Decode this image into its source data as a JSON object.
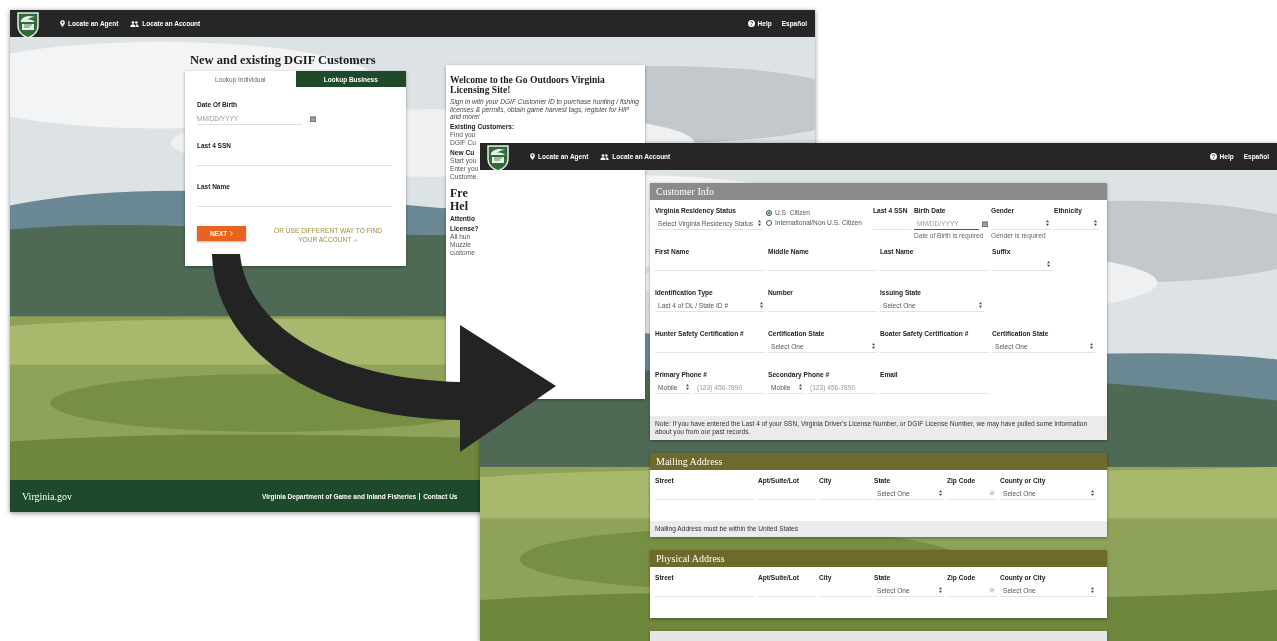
{
  "window_1": {
    "top_bar": {
      "nav": [
        "Locate an Agent",
        "Locate an Account"
      ],
      "help": "Help",
      "language": "Español"
    },
    "heading": "New and existing DGIF Customers",
    "tabs": [
      {
        "label": "Lookup Individual",
        "selected": true
      },
      {
        "label": "Lookup Business",
        "selected": false
      }
    ],
    "fields": [
      {
        "kind": "date",
        "label": "Date Of Birth",
        "placeholder": "MM/DD/YYYY"
      },
      {
        "kind": "text",
        "label": "Last 4 SSN"
      },
      {
        "kind": "text",
        "label": "Last Name"
      }
    ],
    "next_button": "NEXT",
    "alt_link": "OR USE DIFFERENT WAY TO FIND YOUR ACCOUNT",
    "welcome": {
      "title": "Welcome to the Go Outdoors Virginia Licensing Site!",
      "intro": "Sign in with your DGIF Customer ID to purchase hunting / fishing licenses & permits, obtain game harvest tags, register for HIP and more!",
      "sections": [
        {
          "kind": "label",
          "text": "Existing Customers:"
        },
        {
          "kind": "line",
          "text": "Find you"
        },
        {
          "kind": "line",
          "text": "DGIF Cu"
        },
        {
          "kind": "label",
          "text": "New Cu"
        },
        {
          "kind": "line",
          "text": "Start you"
        },
        {
          "kind": "line",
          "text": "Enter you"
        },
        {
          "kind": "line",
          "text": "Custome"
        },
        {
          "kind": "heading",
          "text": "Fre"
        },
        {
          "kind": "heading",
          "text": "Hel"
        },
        {
          "kind": "label",
          "text": "Attentio"
        },
        {
          "kind": "label",
          "text": "License?"
        },
        {
          "kind": "line",
          "text": "All hun"
        },
        {
          "kind": "line",
          "text": "Muzzle"
        },
        {
          "kind": "line",
          "text": "custome"
        }
      ]
    },
    "footer": {
      "brand": "Virginia.gov",
      "links": [
        "Virginia Department of Game and Inland Fisheries",
        "Contact Us"
      ]
    }
  },
  "window_2": {
    "top_bar": {
      "nav": [
        "Locate an Agent",
        "Locate an Account"
      ],
      "help": "Help",
      "language": "Español"
    },
    "cards": [
      {
        "kind": "info",
        "title": "Customer Info",
        "rows": [
          [
            {
              "kind": "select",
              "label": "Virginia Residency Status",
              "value": "Select Virginia Residency Status"
            },
            {
              "kind": "radio",
              "options": [
                {
                  "label": "U.S. Citizen",
                  "selected": true
                },
                {
                  "label": "International/Non U.S. Citizen",
                  "selected": false
                }
              ]
            },
            {
              "kind": "text",
              "label": "Last 4 SSN"
            },
            {
              "kind": "date",
              "label": "Birth Date",
              "placeholder": "MM/DD/YYYY",
              "error": "Date of Birth is required"
            },
            {
              "kind": "select",
              "label": "Gender",
              "error": "Gender is required"
            },
            {
              "kind": "select",
              "label": "Ethnicity"
            }
          ],
          [
            {
              "kind": "text",
              "label": "First Name"
            },
            {
              "kind": "text",
              "label": "Middle Name"
            },
            {
              "kind": "text",
              "label": "Last Name"
            },
            {
              "kind": "select",
              "label": "Suffix"
            }
          ],
          [
            {
              "kind": "select",
              "label": "Identification Type",
              "value": "Last 4 of DL / State ID #"
            },
            {
              "kind": "text",
              "label": "Number"
            },
            {
              "kind": "select",
              "label": "Issuing State",
              "value": "Select One"
            }
          ],
          [
            {
              "kind": "text",
              "label": "Hunter Safety Certification #"
            },
            {
              "kind": "select",
              "label": "Certification State",
              "value": "Select One"
            },
            {
              "kind": "text",
              "label": "Boater Safety Certification #"
            },
            {
              "kind": "select",
              "label": "Certification State",
              "value": "Select One"
            }
          ],
          [
            {
              "kind": "phone",
              "label": "Primary Phone #",
              "type": "Mobile",
              "placeholder": "(123) 456-7890"
            },
            {
              "kind": "phone",
              "label": "Secondary Phone #",
              "type": "Mobile",
              "placeholder": "(123) 456-7890"
            },
            {
              "kind": "text",
              "label": "Email"
            }
          ]
        ],
        "note": "Note: If you have entered the Last 4 of your SSN, Virginia Driver's License Number, or DGIF License Number, we may have pulled some information about you from our past records."
      },
      {
        "kind": "address",
        "title": "Mailing Address",
        "rows": [
          [
            {
              "kind": "text",
              "label": "Street"
            },
            {
              "kind": "text",
              "label": "Apt/Suite/Lot"
            },
            {
              "kind": "text",
              "label": "City"
            },
            {
              "kind": "select",
              "label": "State",
              "value": "Select One"
            },
            {
              "kind": "text",
              "label": "Zip Code",
              "verified": true
            },
            {
              "kind": "select",
              "label": "County or City",
              "value": "Select One"
            }
          ]
        ],
        "note": "Mailing Address must be within the United States"
      },
      {
        "kind": "address",
        "title": "Physical Address",
        "rows": [
          [
            {
              "kind": "text",
              "label": "Street"
            },
            {
              "kind": "text",
              "label": "Apt/Suite/Lot"
            },
            {
              "kind": "text",
              "label": "City"
            },
            {
              "kind": "select",
              "label": "State",
              "value": "Select One"
            },
            {
              "kind": "text",
              "label": "Zip Code",
              "verified": true
            },
            {
              "kind": "select",
              "label": "County or City",
              "value": "Select One"
            }
          ]
        ]
      },
      {
        "kind": "cut"
      }
    ]
  }
}
